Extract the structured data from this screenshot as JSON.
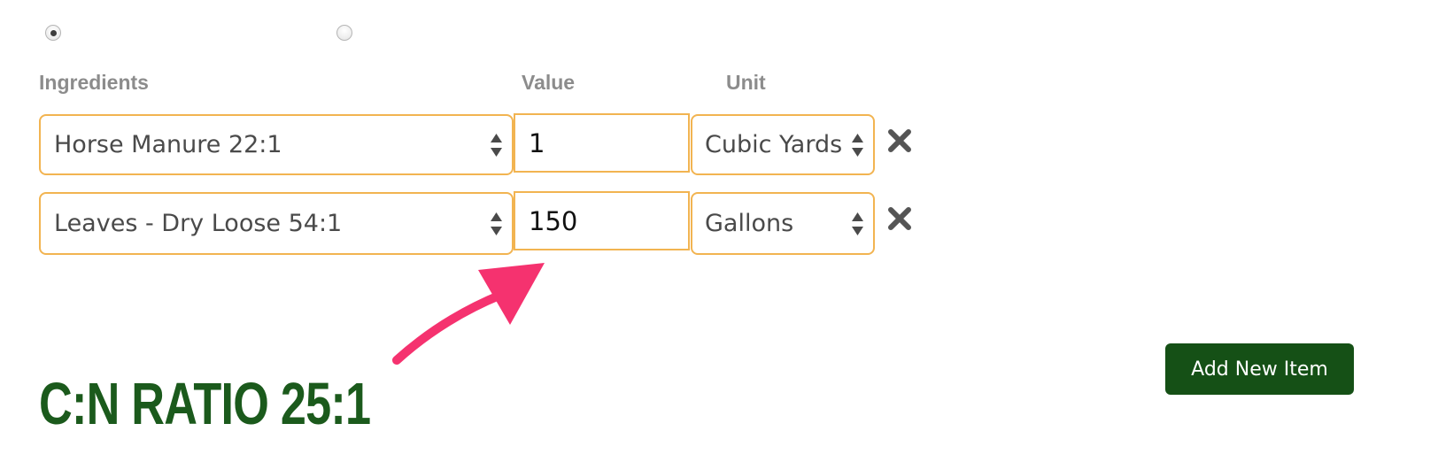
{
  "options": [
    {
      "selected": true
    },
    {
      "selected": false
    }
  ],
  "table": {
    "headers": {
      "ingredients": "Ingredients",
      "value": "Value",
      "unit": "Unit"
    },
    "rows": [
      {
        "ingredient": "Horse Manure 22:1",
        "value": "1",
        "unit": "Cubic Yards"
      },
      {
        "ingredient": "Leaves - Dry Loose 54:1",
        "value": "150",
        "unit": "Gallons"
      }
    ]
  },
  "add_button": {
    "label": "Add New Item"
  },
  "result": {
    "ratio_text": "C:N RATIO 25:1"
  },
  "annotation": {
    "arrow_color": "#f5326f"
  },
  "colors": {
    "field_border": "#f2b451",
    "button_bg": "#155016",
    "ratio_text": "#1b5a1c",
    "header_text": "#8c8c8c"
  },
  "icons": {
    "remove": "close-icon",
    "select_arrows": "chevron-up-down-icon"
  }
}
